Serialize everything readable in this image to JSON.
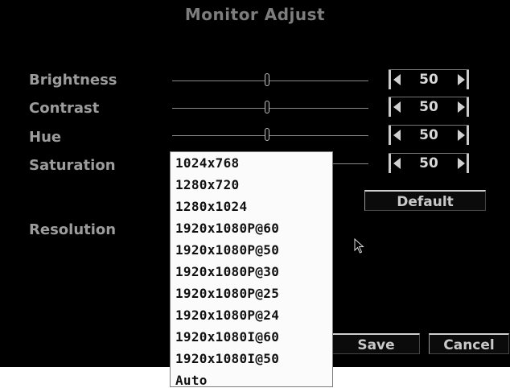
{
  "window": {
    "title": "Monitor Adjust"
  },
  "settings": [
    {
      "label": "Brightness",
      "value": "50",
      "level": 50
    },
    {
      "label": "Contrast",
      "value": "50",
      "level": 50
    },
    {
      "label": "Hue",
      "value": "50",
      "level": 50
    },
    {
      "label": "Saturation",
      "value": "50",
      "level": 50
    }
  ],
  "default_label": "Default",
  "resolution": {
    "label": "Resolution",
    "options": [
      "1024x768",
      "1280x720",
      "1280x1024",
      "1920x1080P@60",
      "1920x1080P@50",
      "1920x1080P@30",
      "1920x1080P@25",
      "1920x1080P@24",
      "1920x1080I@60",
      "1920x1080I@50",
      "Auto"
    ]
  },
  "footer": {
    "save_label": "Save",
    "cancel_label": "Cancel"
  },
  "colors": {
    "panel": "#000000",
    "label": "#9c9c9c",
    "stepper_frame": "#c9c9c9",
    "dropdown_bg": "#fbfbfb"
  },
  "icons": [
    "arrow-left-icon",
    "arrow-right-icon",
    "mouse-cursor-icon"
  ]
}
